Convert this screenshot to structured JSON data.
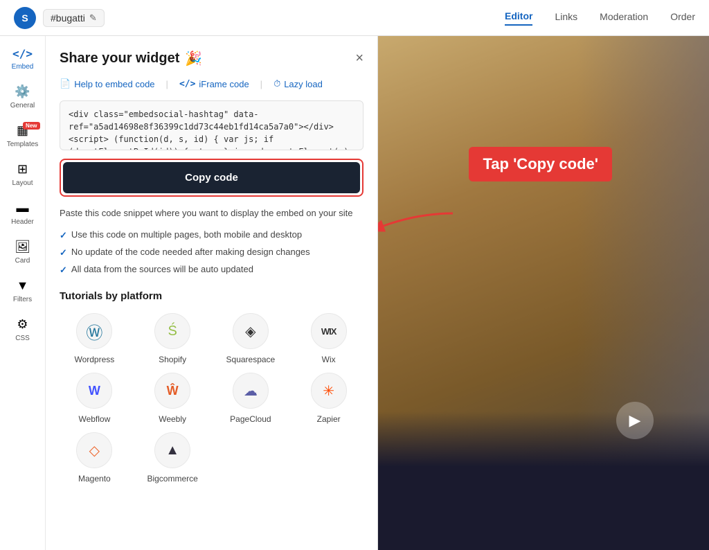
{
  "topNav": {
    "logo": "S",
    "hashtag": "#bugatti",
    "navItems": [
      {
        "id": "editor",
        "label": "Editor",
        "active": true
      },
      {
        "id": "links",
        "label": "Links",
        "active": false
      },
      {
        "id": "moderation",
        "label": "Moderation",
        "active": false
      },
      {
        "id": "order",
        "label": "Order",
        "active": false
      }
    ]
  },
  "sidebar": {
    "items": [
      {
        "id": "embed",
        "icon": "</>",
        "label": "Embed",
        "active": true
      },
      {
        "id": "general",
        "icon": "⚙",
        "label": "General",
        "active": false
      },
      {
        "id": "templates",
        "icon": "▦",
        "label": "Templates",
        "active": false,
        "badge": "New"
      },
      {
        "id": "layout",
        "icon": "⊞",
        "label": "Layout",
        "active": false
      },
      {
        "id": "header",
        "icon": "▬",
        "label": "Header",
        "active": false
      },
      {
        "id": "card",
        "icon": "🖼",
        "label": "Card",
        "active": false
      },
      {
        "id": "filters",
        "icon": "▼",
        "label": "Filters",
        "active": false
      },
      {
        "id": "css",
        "icon": "⚙",
        "label": "CSS",
        "active": false
      }
    ]
  },
  "dialog": {
    "title": "Share your widget",
    "titleEmoji": "🎉",
    "closeLabel": "×",
    "tabs": [
      {
        "id": "help",
        "icon": "📄",
        "label": "Help to embed code"
      },
      {
        "id": "iframe",
        "icon": "</>",
        "label": "iFrame code"
      },
      {
        "id": "lazy",
        "icon": "⏱",
        "label": "Lazy load"
      }
    ],
    "codeSnippet": "<div class=\"embedsocial-hashtag\" data-ref=\"a5ad14698e8f36399c1dd73c44eb1fd14ca5a7a0\"></div> <script> (function(d, s, id) { var js; if (d.getElementById(id)) {return;} js = d.createElement(s); js.id = id; js.src = \"https://embedsoci...",
    "copyButtonLabel": "Copy code",
    "infoText": "Paste this code snippet where you want to display the embed on your site",
    "checklistItems": [
      "Use this code on multiple pages, both mobile and desktop",
      "No update of the code needed after making design changes",
      "All data from the sources will be auto updated"
    ],
    "tutorialsTitle": "Tutorials by platform",
    "platforms": [
      {
        "id": "wordpress",
        "icon": "Ⓦ",
        "label": "Wordpress"
      },
      {
        "id": "shopify",
        "icon": "Ś",
        "label": "Shopify"
      },
      {
        "id": "squarespace",
        "icon": "◈",
        "label": "Squarespace"
      },
      {
        "id": "wix",
        "icon": "WX",
        "label": "Wix"
      },
      {
        "id": "webflow",
        "icon": "W",
        "label": "Webflow"
      },
      {
        "id": "weebly",
        "icon": "W",
        "label": "Weebly"
      },
      {
        "id": "pagecloud",
        "icon": "☁",
        "label": "PageCloud"
      },
      {
        "id": "zapier",
        "icon": "✳",
        "label": "Zapier"
      },
      {
        "id": "magento",
        "icon": "◇",
        "label": "Magento"
      },
      {
        "id": "bigcommerce",
        "icon": "▲",
        "label": "Bigcommerce"
      }
    ]
  },
  "preview": {
    "tapLabel": "Tap 'Copy code'"
  }
}
